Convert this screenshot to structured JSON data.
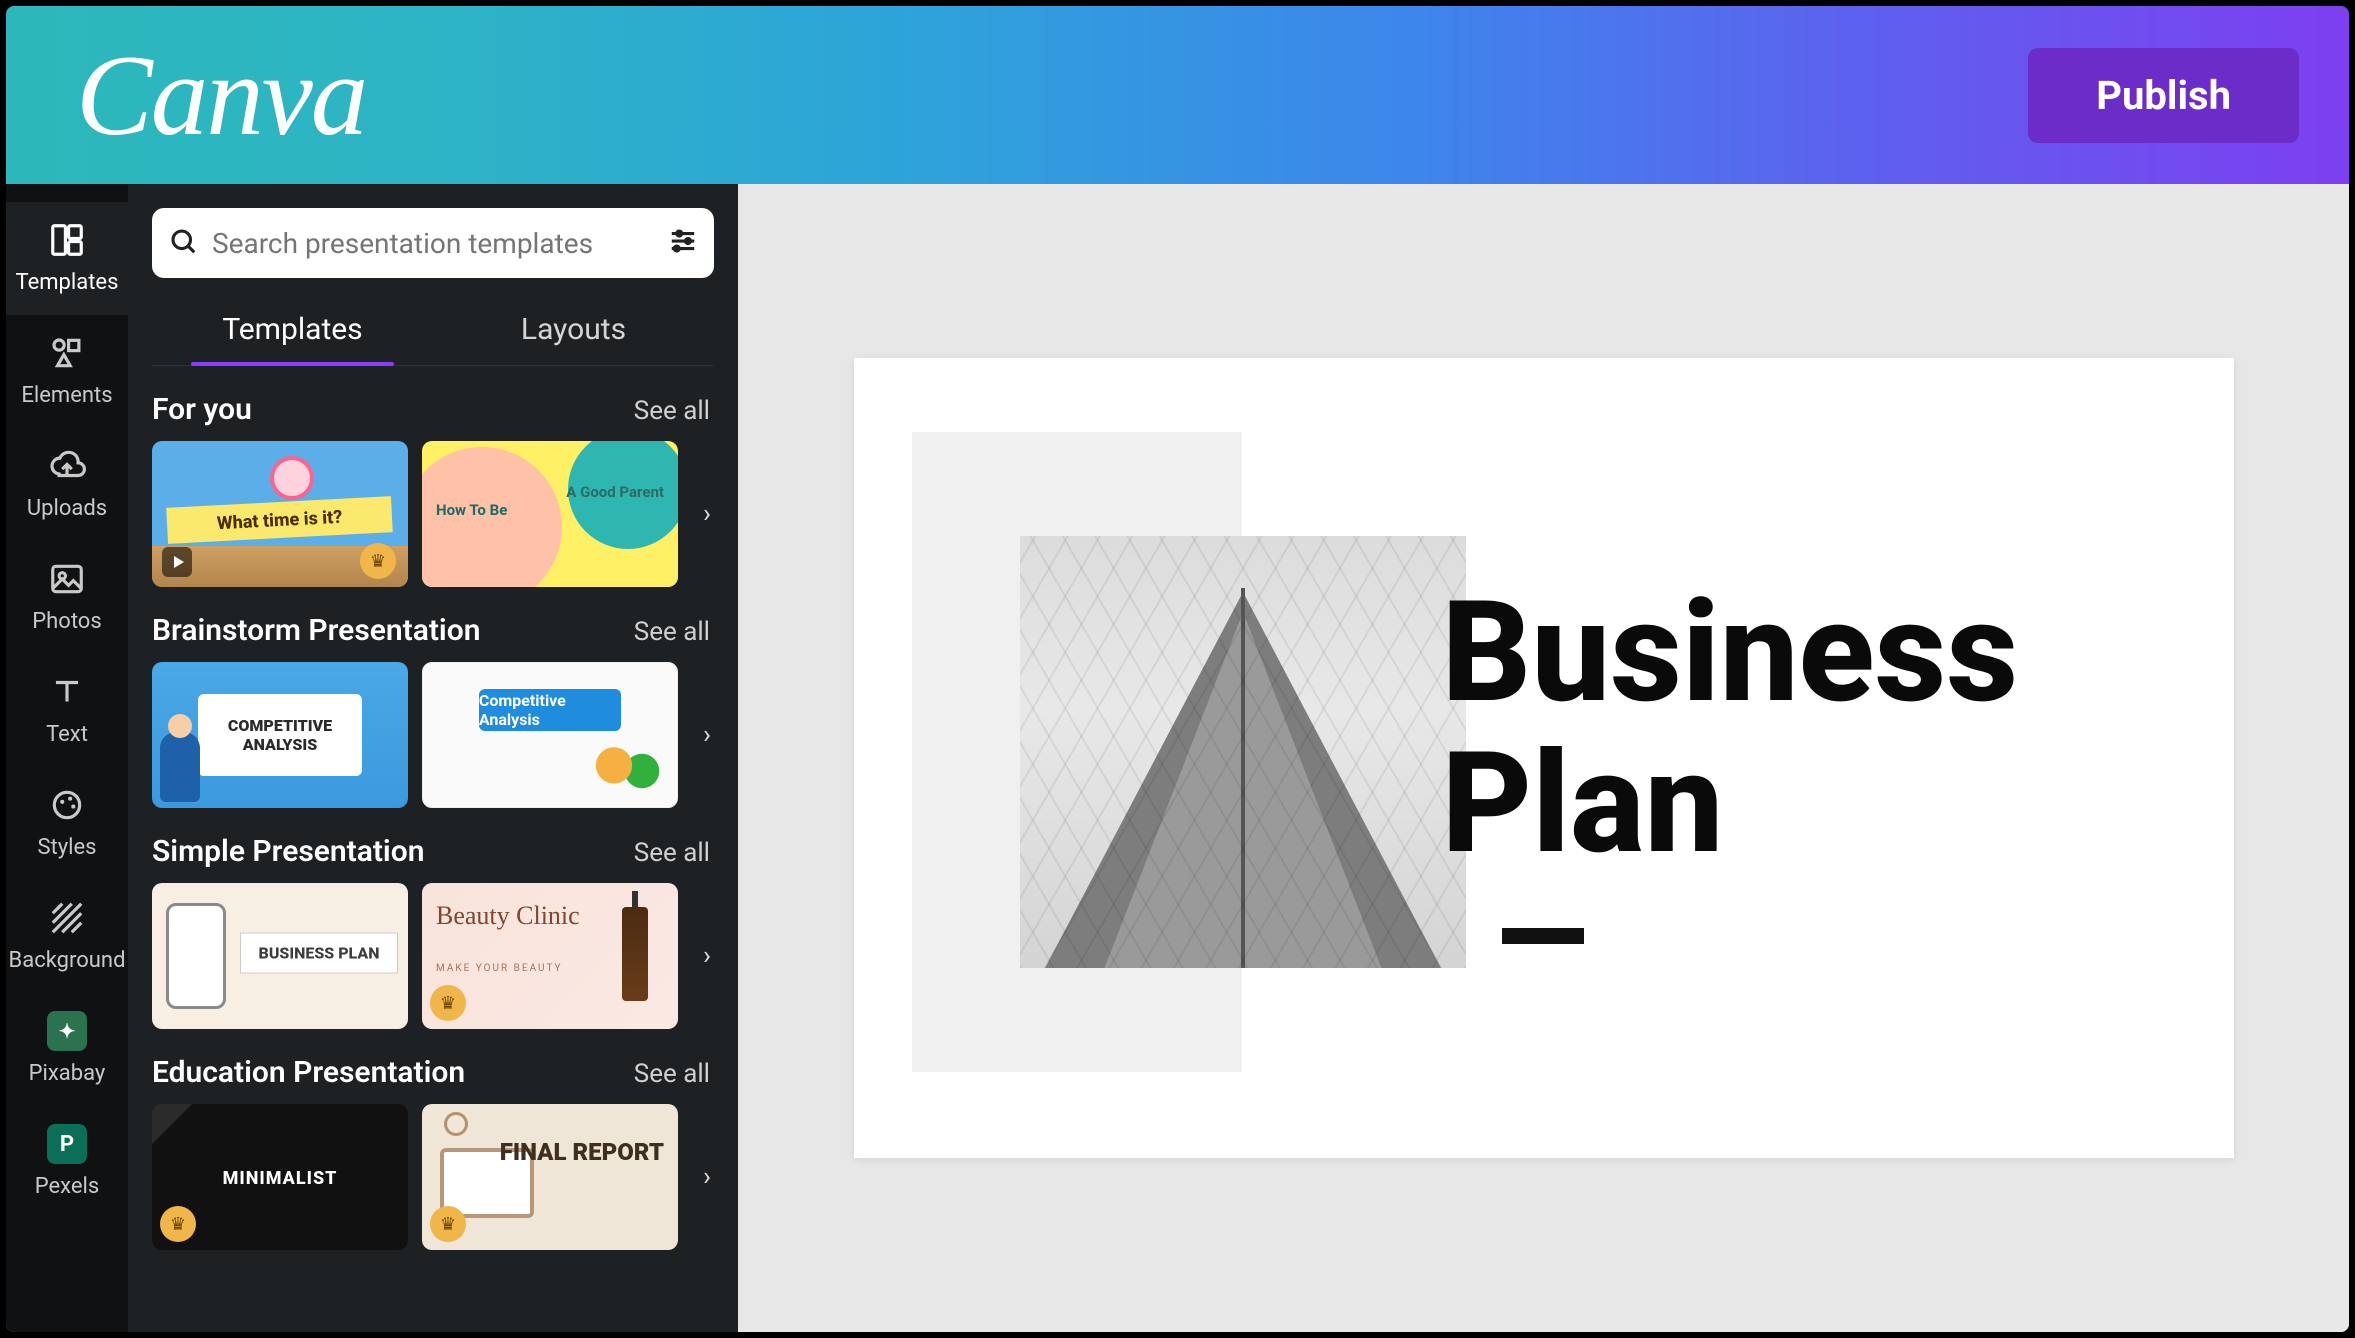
{
  "header": {
    "logo_text": "Canva",
    "publish_label": "Publish"
  },
  "rail": {
    "items": [
      {
        "id": "templates",
        "label": "Templates",
        "icon": "templates-icon",
        "active": true
      },
      {
        "id": "elements",
        "label": "Elements",
        "icon": "elements-icon",
        "active": false
      },
      {
        "id": "uploads",
        "label": "Uploads",
        "icon": "uploads-icon",
        "active": false
      },
      {
        "id": "photos",
        "label": "Photos",
        "icon": "photos-icon",
        "active": false
      },
      {
        "id": "text",
        "label": "Text",
        "icon": "text-icon",
        "active": false
      },
      {
        "id": "styles",
        "label": "Styles",
        "icon": "styles-icon",
        "active": false
      },
      {
        "id": "background",
        "label": "Background",
        "icon": "background-icon",
        "active": false
      },
      {
        "id": "pixabay",
        "label": "Pixabay",
        "icon": "pixabay-icon",
        "active": false
      },
      {
        "id": "pexels",
        "label": "Pexels",
        "icon": "pexels-icon",
        "active": false
      }
    ]
  },
  "panel": {
    "search_placeholder": "Search presentation templates",
    "tabs": [
      {
        "id": "templates",
        "label": "Templates",
        "active": true
      },
      {
        "id": "layouts",
        "label": "Layouts",
        "active": false
      }
    ],
    "see_all_label": "See all",
    "sections": [
      {
        "title": "For you",
        "cards": [
          {
            "id": "for-you-1",
            "text": "What time is it?",
            "has_play": true,
            "has_crown": true,
            "crown_side": "r"
          },
          {
            "id": "for-you-2",
            "text_left": "How To Be",
            "text_right": "A Good Parent"
          }
        ]
      },
      {
        "title": "Brainstorm Presentation",
        "cards": [
          {
            "id": "bs-1",
            "text": "COMPETITIVE ANALYSIS"
          },
          {
            "id": "bs-2",
            "text": "Competitive Analysis"
          }
        ]
      },
      {
        "title": "Simple Presentation",
        "cards": [
          {
            "id": "sp-1",
            "text": "BUSINESS PLAN"
          },
          {
            "id": "sp-2",
            "text": "Beauty Clinic",
            "subtext": "MAKE YOUR BEAUTY",
            "has_crown": true
          }
        ]
      },
      {
        "title": "Education Presentation",
        "cards": [
          {
            "id": "ed-1",
            "text": "MINIMALIST",
            "has_crown": true
          },
          {
            "id": "ed-2",
            "text": "FINAL REPORT",
            "has_crown": true
          }
        ]
      }
    ]
  },
  "slide": {
    "title_line1": "Business",
    "title_line2": "Plan"
  }
}
